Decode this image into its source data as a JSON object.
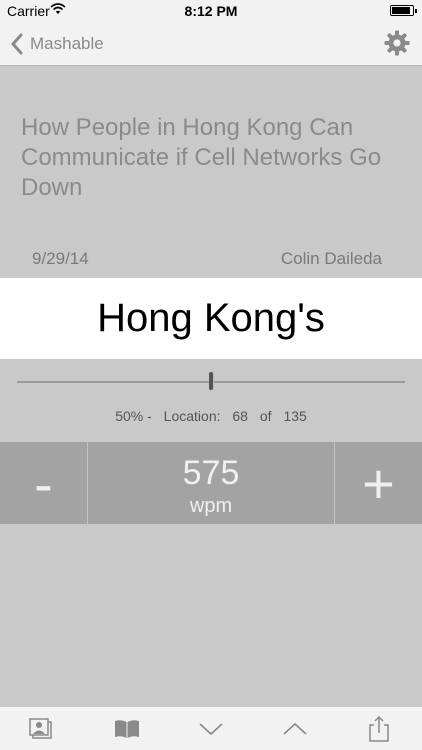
{
  "status_bar": {
    "carrier": "Carrier",
    "time": "8:12 PM"
  },
  "nav": {
    "back_label": "Mashable"
  },
  "article": {
    "title": "How People in Hong Kong Can Communicate if Cell Networks Go Down",
    "date": "9/29/14",
    "author": "Colin Daileda"
  },
  "reader": {
    "current_word": "Hong Kong's",
    "progress_fraction": 0.5,
    "location": {
      "percent": "50% -",
      "label": "Location:",
      "current": "68",
      "of": "of",
      "total": "135"
    }
  },
  "speed": {
    "minus": "-",
    "value": "575",
    "unit": "wpm",
    "plus": "+"
  },
  "toolbar": {
    "icons": [
      "photos-icon",
      "book-icon",
      "chevron-down-icon",
      "chevron-up-icon",
      "share-icon"
    ]
  },
  "colors": {
    "background": "#c9c9c9",
    "bar": "#f2f2f2",
    "speedbar": "#a3a3a3",
    "icon": "#8a8a8a"
  }
}
